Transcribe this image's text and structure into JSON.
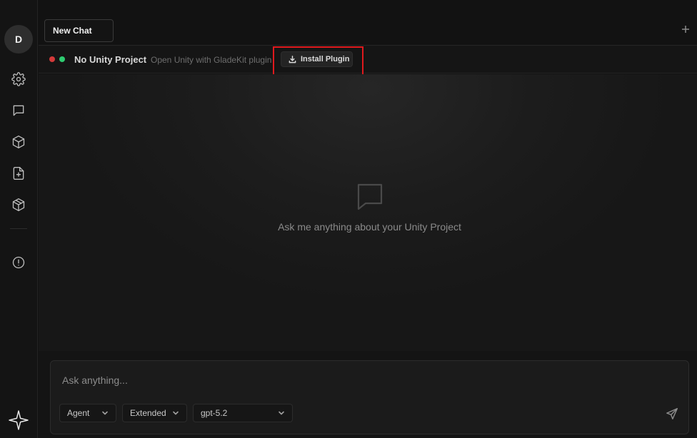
{
  "user": {
    "avatar_initial": "D"
  },
  "sidebar": {
    "items": [
      {
        "icon": "gear-icon"
      },
      {
        "icon": "chat-bubble-icon"
      },
      {
        "icon": "cube-icon"
      },
      {
        "icon": "file-plus-icon"
      },
      {
        "icon": "package-icon"
      },
      {
        "icon": "alert-circle-icon"
      }
    ],
    "logo_icon": "sparkle-star-icon"
  },
  "tabs": [
    {
      "label": "New Chat"
    }
  ],
  "status": {
    "title": "No Unity Project",
    "subtitle": "Open Unity with GladeKit plugin",
    "install_label": "Install Plugin",
    "indicator_colors": [
      "#d33a3a",
      "#2ecc71"
    ]
  },
  "empty_state": {
    "icon": "chat-bubble-icon",
    "message": "Ask me anything about your Unity Project"
  },
  "composer": {
    "placeholder": "Ask anything...",
    "mode": "Agent",
    "thinking": "Extended",
    "model": "gpt-5.2"
  },
  "colors": {
    "highlight": "#e0191d"
  }
}
